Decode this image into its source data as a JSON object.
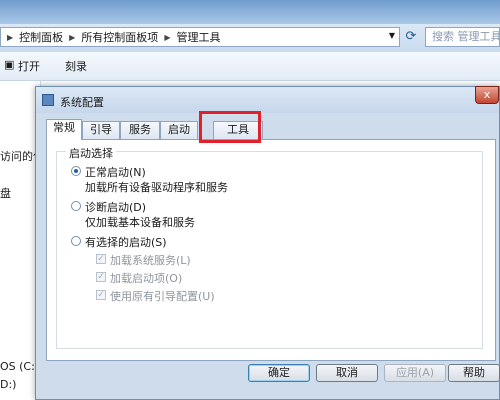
{
  "explorer": {
    "breadcrumb": [
      "控制面板",
      "所有控制面板项",
      "管理工具"
    ],
    "search_placeholder": "搜索 管理工具",
    "toolbar": {
      "open_label": "打开",
      "burn_label": "刻录"
    },
    "left_pane": {
      "item_1": "访问的位",
      "item_2": "盘",
      "drive_c": "OS (C:)",
      "drive_d": "D:)"
    }
  },
  "dialog": {
    "title": "系统配置",
    "close_label": "x",
    "tabs": [
      "常规",
      "引导",
      "服务",
      "启动",
      "工具"
    ],
    "active_tab": "常规",
    "group_title": "启动选择",
    "options": {
      "normal": {
        "label": "正常启动(N)",
        "desc": "加载所有设备驱动程序和服务",
        "selected": true
      },
      "diagnostic": {
        "label": "诊断启动(D)",
        "desc": "仅加载基本设备和服务",
        "selected": false
      },
      "selective": {
        "label": "有选择的启动(S)",
        "selected": false
      }
    },
    "selective_items": [
      {
        "label": "加载系统服务(L)",
        "checked": true
      },
      {
        "label": "加载启动项(O)",
        "checked": true
      },
      {
        "label": "使用原有引导配置(U)",
        "checked": true
      }
    ],
    "buttons": {
      "ok": "确定",
      "cancel": "取消",
      "apply": "应用(A)",
      "help": "帮助"
    }
  },
  "colors": {
    "highlight": "#e0202a",
    "accent": "#1f5ea8"
  }
}
